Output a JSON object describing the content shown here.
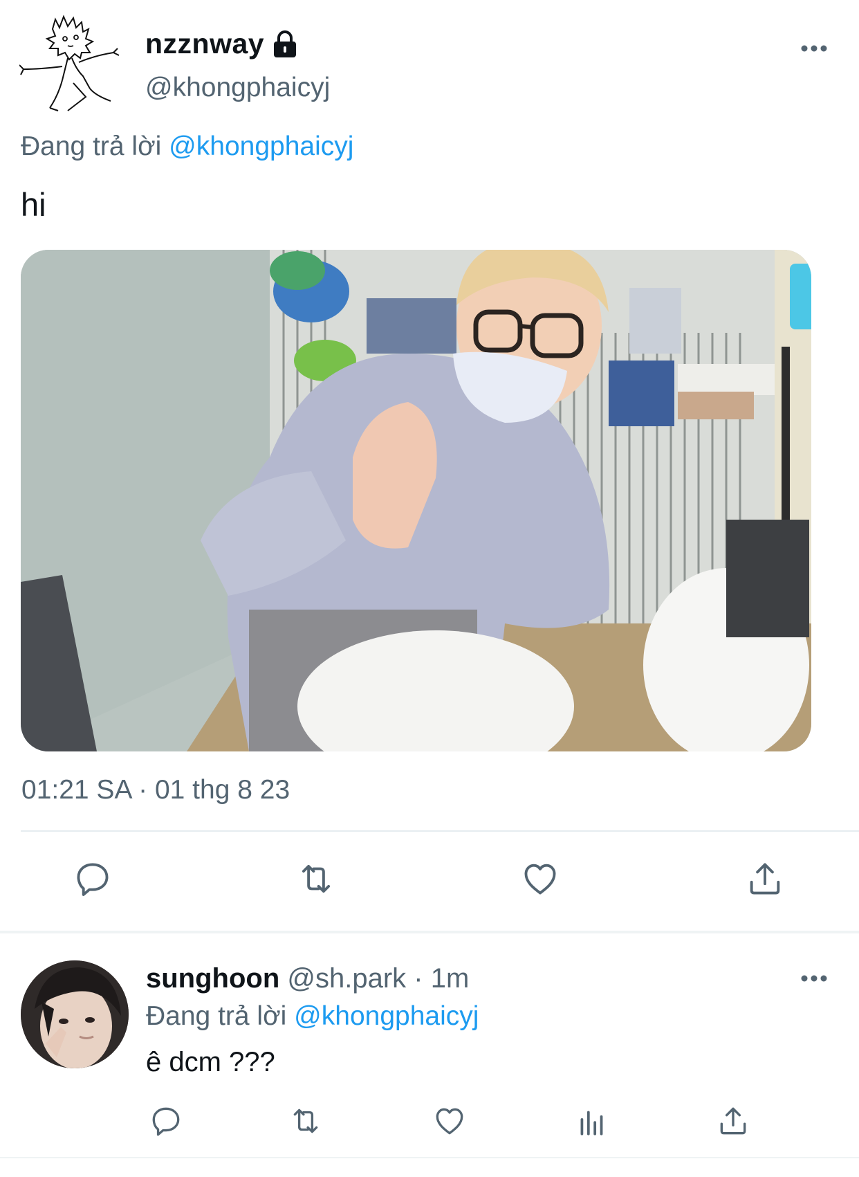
{
  "tweet": {
    "display_name": "nzznway",
    "handle": "@khongphaicyj",
    "replying_prefix": "Đang trả lời",
    "replying_to": "@khongphaicyj",
    "text": "hi",
    "timestamp": "01:21 SA · 01 thg 8 23",
    "media_icon": "photo",
    "protected_icon": "lock-icon",
    "actions": [
      "reply-icon",
      "retweet-icon",
      "like-icon",
      "share-icon"
    ]
  },
  "reply": {
    "display_name": "sunghoon",
    "handle": "@sh.park",
    "separator": " · ",
    "time": "1m",
    "replying_prefix": "Đang trả lời",
    "replying_to": "@khongphaicyj",
    "text": "ê dcm ???",
    "actions": [
      "reply-icon",
      "retweet-icon",
      "like-icon",
      "analytics-icon",
      "share-icon"
    ]
  },
  "colors": {
    "text": "#0f1419",
    "secondary": "#536471",
    "link": "#1d9bf0",
    "divider": "#e6ecf0"
  }
}
